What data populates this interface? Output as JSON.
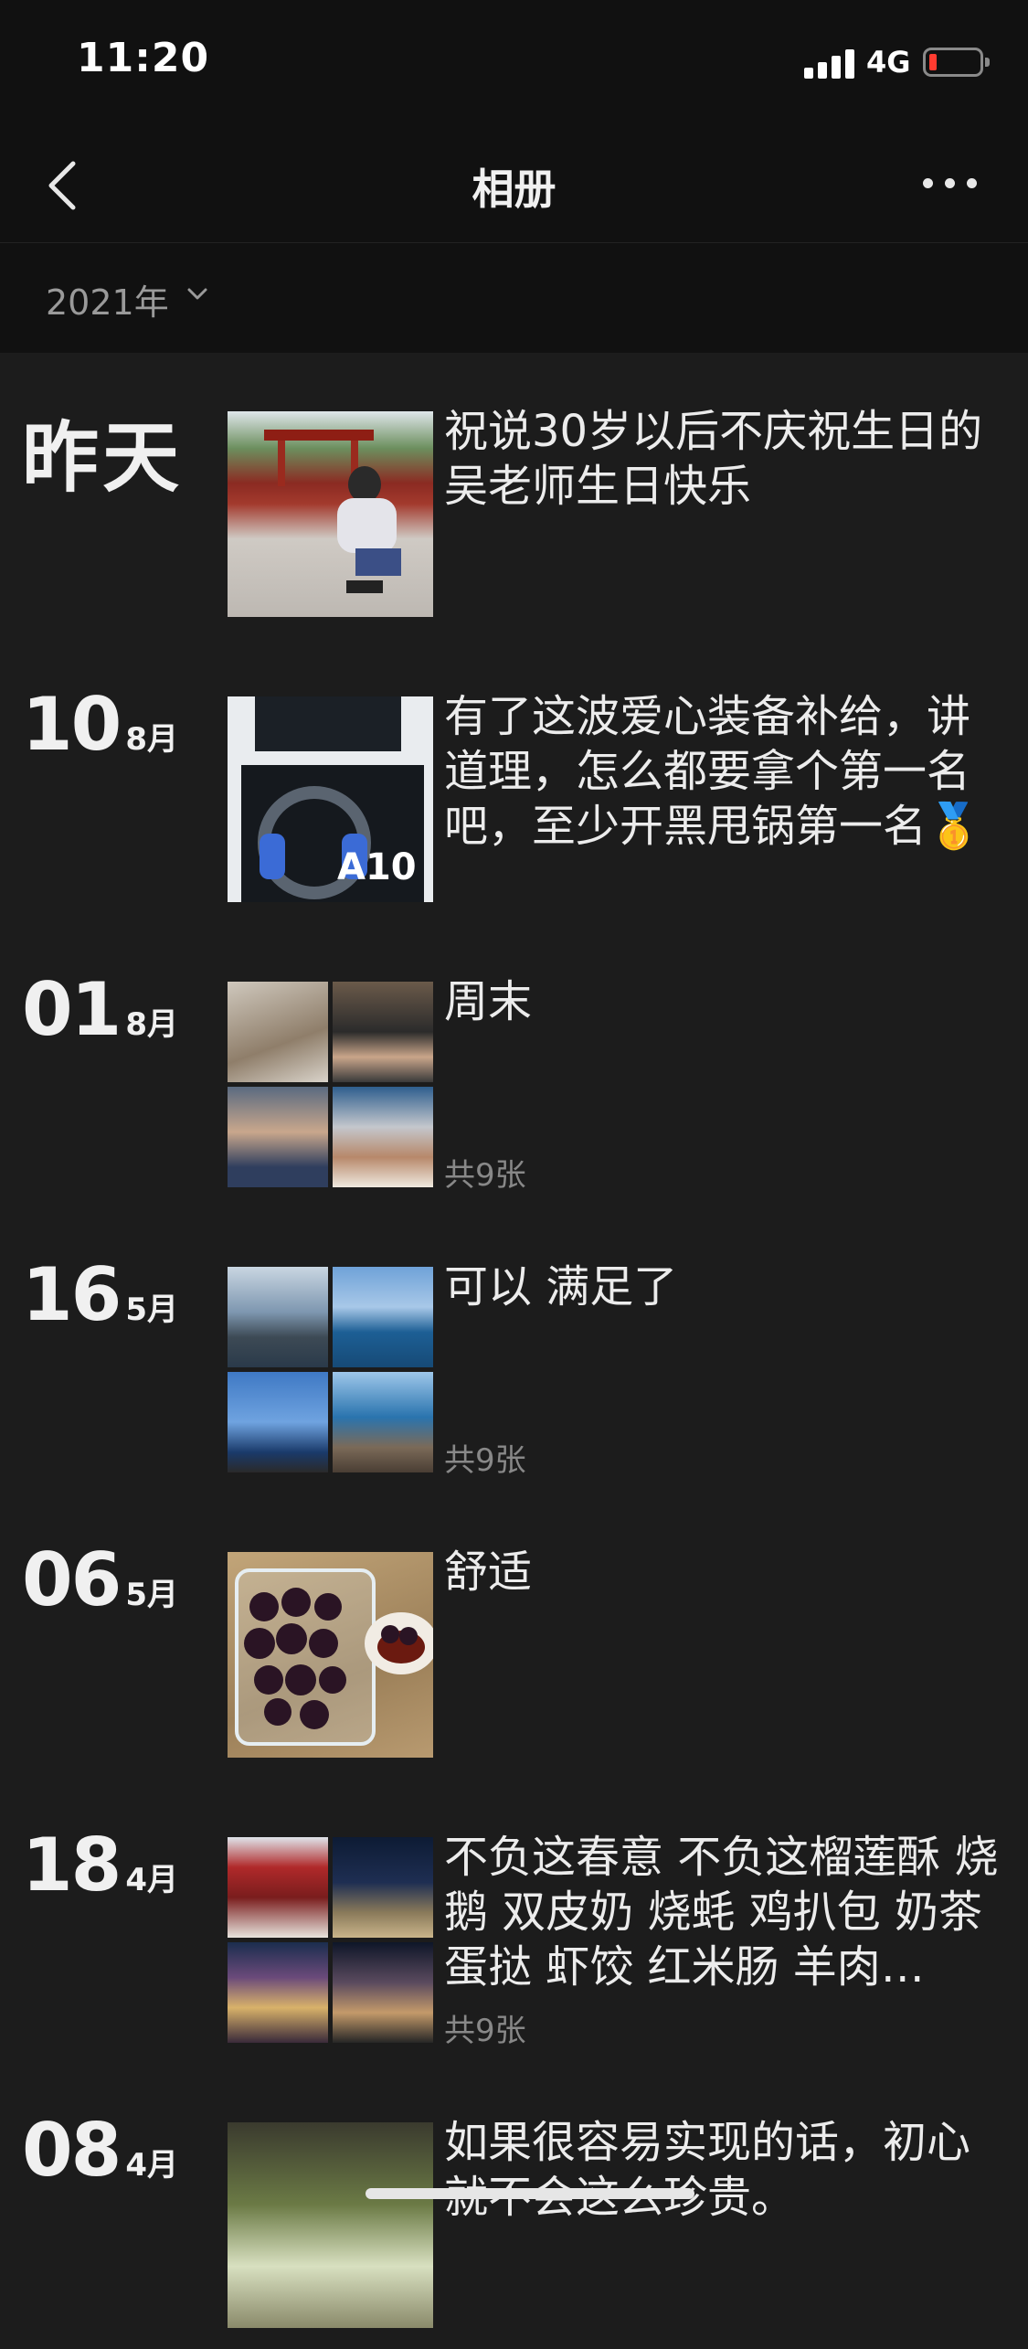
{
  "status_bar": {
    "time": "11:20",
    "network": "4G"
  },
  "nav": {
    "title": "相册"
  },
  "year_filter": {
    "label": "2021年"
  },
  "entries": [
    {
      "date_word": "昨天",
      "text": "祝说30岁以后不庆祝生日的吴老师生日快乐",
      "count": ""
    },
    {
      "day": "10",
      "month": "8月",
      "text": "有了这波爱心装备补给，讲道理，怎么都要拿个第一名吧，至少开黑甩锅第一名🥇",
      "count": ""
    },
    {
      "day": "01",
      "month": "8月",
      "text": "周末",
      "count": "共9张"
    },
    {
      "day": "16",
      "month": "5月",
      "text": "可以 满足了",
      "count": "共9张"
    },
    {
      "day": "06",
      "month": "5月",
      "text": "舒适",
      "count": ""
    },
    {
      "day": "18",
      "month": "4月",
      "text": "不负这春意 不负这榴莲酥 烧鹅 双皮奶 烧蚝 鸡扒包 奶茶蛋挞 虾饺 红米肠 羊肉…",
      "count": "共9张"
    },
    {
      "day": "08",
      "month": "4月",
      "text": "如果很容易实现的话，初心就不会这么珍贵。",
      "count": ""
    }
  ]
}
